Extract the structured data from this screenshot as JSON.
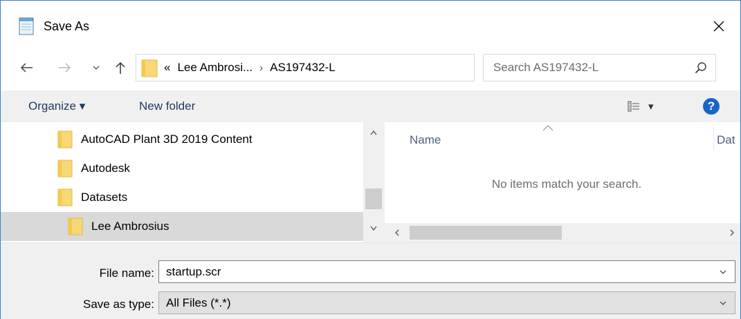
{
  "window": {
    "title": "Save As",
    "accent_color": "#3a7dc9"
  },
  "nav": {
    "back_icon": "back-arrow-icon",
    "forward_icon": "forward-arrow-icon",
    "recent_icon": "chevron-down-icon",
    "up_icon": "up-arrow-icon"
  },
  "address": {
    "overflow": "«",
    "crumbs": [
      "Lee Ambrosi...",
      "AS197432-L"
    ],
    "separator": "›"
  },
  "search": {
    "placeholder": "Search AS197432-L"
  },
  "toolbar": {
    "organize_label": "Organize ▾",
    "new_folder_label": "New folder",
    "view_label": "▾",
    "help_label": "?",
    "help_color": "#1a64c8"
  },
  "tree": {
    "items": [
      {
        "label": "AutoCAD Plant 3D 2019 Content",
        "selected": false
      },
      {
        "label": "Autodesk",
        "selected": false
      },
      {
        "label": "Datasets",
        "selected": false
      },
      {
        "label": "Lee Ambrosius",
        "selected": true
      }
    ]
  },
  "filelist": {
    "columns": [
      "Name",
      "Dat"
    ],
    "empty_message": "No items match your search."
  },
  "form": {
    "file_name_label": "File name:",
    "file_name_value": "startup.scr",
    "save_type_label": "Save as type:",
    "save_type_value": "All Files  (*.*)"
  }
}
